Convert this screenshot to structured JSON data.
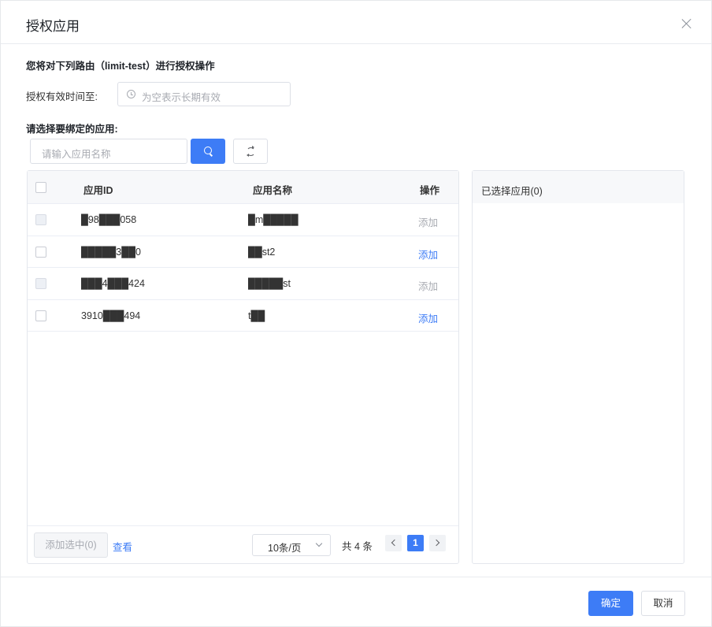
{
  "dialog": {
    "title": "授权应用",
    "description": "您将对下列路由（limit-test）进行授权操作",
    "valid_label": "授权有效时间至:",
    "valid_placeholder": "为空表示长期有效",
    "select_label": "请选择要绑定的应用:",
    "search_placeholder": "请输入应用名称"
  },
  "icons": {
    "close": "close-icon",
    "clock": "clock-icon",
    "search": "search-icon",
    "refresh": "refresh-icon"
  },
  "table": {
    "columns": {
      "id": "应用ID",
      "name": "应用名称",
      "action": "操作"
    },
    "rows": [
      {
        "id": "█98███058",
        "name": "█m█████",
        "action": "添加",
        "enabled": false
      },
      {
        "id": "█████3██0",
        "name": "██st2",
        "action": "添加",
        "enabled": true
      },
      {
        "id": "███4███424",
        "name": "█████st",
        "action": "添加",
        "enabled": false
      },
      {
        "id": "3910███494",
        "name": "t██",
        "action": "添加",
        "enabled": true
      }
    ],
    "add_selected_label": "添加选中(0)",
    "view_label": "查看",
    "page_size_label": "10条/页",
    "total_label": "共 4 条",
    "current_page": "1"
  },
  "selected_panel": {
    "title": "已选择应用(0)"
  },
  "footer": {
    "ok_label": "确定",
    "cancel_label": "取消"
  },
  "colors": {
    "primary": "#3d7cf6",
    "disabled_text": "#a8abb2",
    "header_bg": "#f7f8fa"
  }
}
